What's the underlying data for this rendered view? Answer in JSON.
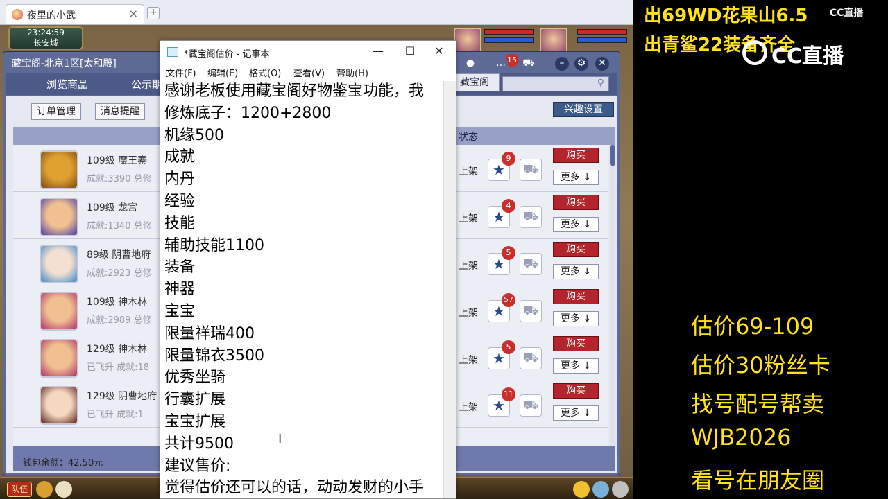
{
  "browser": {
    "tab_title": "夜里的小武",
    "tab_close": "×",
    "new_tab": "+"
  },
  "game": {
    "clock": "23:24:59",
    "location": "长安城",
    "team_button": "队伍"
  },
  "cbg": {
    "title": "藏宝阁-北京1区[太和殿]",
    "nav": [
      "浏览商品",
      "公示期"
    ],
    "tab_label": "藏宝阁",
    "msg_count": "15",
    "buttons": {
      "orders": "订单管理",
      "messages": "消息提醒",
      "interest": "兴趣设置"
    },
    "status_header": "状态",
    "wallet": "钱包余额：42.50元",
    "rows": [
      {
        "line1": "109级  魔王寨",
        "line2": "成就:3390 总修",
        "status": "上架",
        "fav": "9",
        "buy": "购买",
        "more": "更多 ↓",
        "c1": "#e0a030",
        "c2": "#7a4a18"
      },
      {
        "line1": "109级  龙宫",
        "line2": "成就:1340 总修",
        "status": "上架",
        "fav": "4",
        "buy": "购买",
        "more": "更多 ↓",
        "c1": "#f0c090",
        "c2": "#4a3aa8"
      },
      {
        "line1": "89级  阴曹地府",
        "line2": "成就:2923 总修",
        "status": "上架",
        "fav": "5",
        "buy": "购买",
        "more": "更多 ↓",
        "c1": "#f4e0d0",
        "c2": "#3a8ac8"
      },
      {
        "line1": "109级  神木林",
        "line2": "成就:2989 总修",
        "status": "上架",
        "fav": "57",
        "buy": "购买",
        "more": "更多 ↓",
        "c1": "#f0c090",
        "c2": "#b0306a"
      },
      {
        "line1": "129级  神木林",
        "line2": "已飞升  成就:18",
        "status": "上架",
        "fav": "5",
        "buy": "购买",
        "more": "更多 ↓",
        "c1": "#f0c090",
        "c2": "#b0306a"
      },
      {
        "line1": "129级  阴曹地府",
        "line2": "已飞升  成就:1",
        "status": "上架",
        "fav": "11",
        "buy": "购买",
        "more": "更多 ↓",
        "c1": "#f6d8c0",
        "c2": "#5a2018"
      }
    ]
  },
  "notepad": {
    "title": "*藏宝阁估价 - 记事本",
    "controls": {
      "minimize": "—",
      "maximize": "☐",
      "close": "✕"
    },
    "menu": [
      "文件(F)",
      "编辑(E)",
      "格式(O)",
      "查看(V)",
      "帮助(H)"
    ],
    "lines": [
      "感谢老板使用藏宝阁好物鉴宝功能，我",
      "修炼底子：1200+2800",
      "机缘500",
      "成就",
      "内丹",
      "经验",
      "技能",
      "辅助技能1100",
      "装备",
      "神器",
      "宝宝",
      "限量祥瑞400",
      "限量锦衣3500",
      "优秀坐骑",
      "行囊扩展",
      "宝宝扩展",
      "共计9500",
      "建议售价:",
      "觉得估价还可以的话，动动发财的小手"
    ]
  },
  "overlay": {
    "top_lines": [
      "出69WD花果山6.5",
      "出青鲨22装备齐全"
    ],
    "logo": "CC直播",
    "logo_small": "CC直播",
    "lines": [
      "估价69-109",
      "估价30粉丝卡",
      "找号配号帮卖",
      " WJB2026",
      "看号在朋友圈"
    ],
    "accent": "#ffe21a"
  }
}
